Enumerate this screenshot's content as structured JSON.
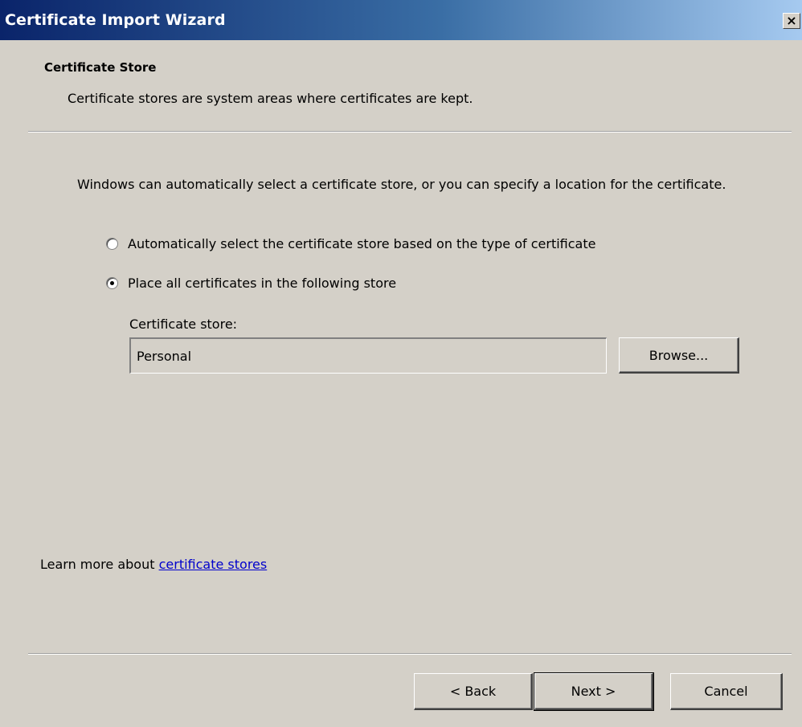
{
  "window": {
    "title": "Certificate Import Wizard",
    "close_glyph": "×"
  },
  "header": {
    "title": "Certificate Store",
    "subtitle": "Certificate stores are system areas where certificates are kept."
  },
  "body": {
    "intro": "Windows can automatically select a certificate store, or you can specify a location for the certificate.",
    "options": [
      {
        "label": "Automatically select the certificate store based on the type of certificate",
        "selected": false
      },
      {
        "label": "Place all certificates in the following store",
        "selected": true
      }
    ],
    "store_label": "Certificate store:",
    "store_value": "Personal",
    "browse_label": "Browse...",
    "learn_more_prefix": "Learn more about",
    "learn_more_link": "certificate stores"
  },
  "footer": {
    "back_label": "< Back",
    "next_label": "Next >",
    "cancel_label": "Cancel"
  },
  "colors": {
    "title_start": "#0a246a",
    "title_end": "#a6caf0",
    "dialog_bg": "#d4d0c8",
    "link": "#0000cc"
  }
}
